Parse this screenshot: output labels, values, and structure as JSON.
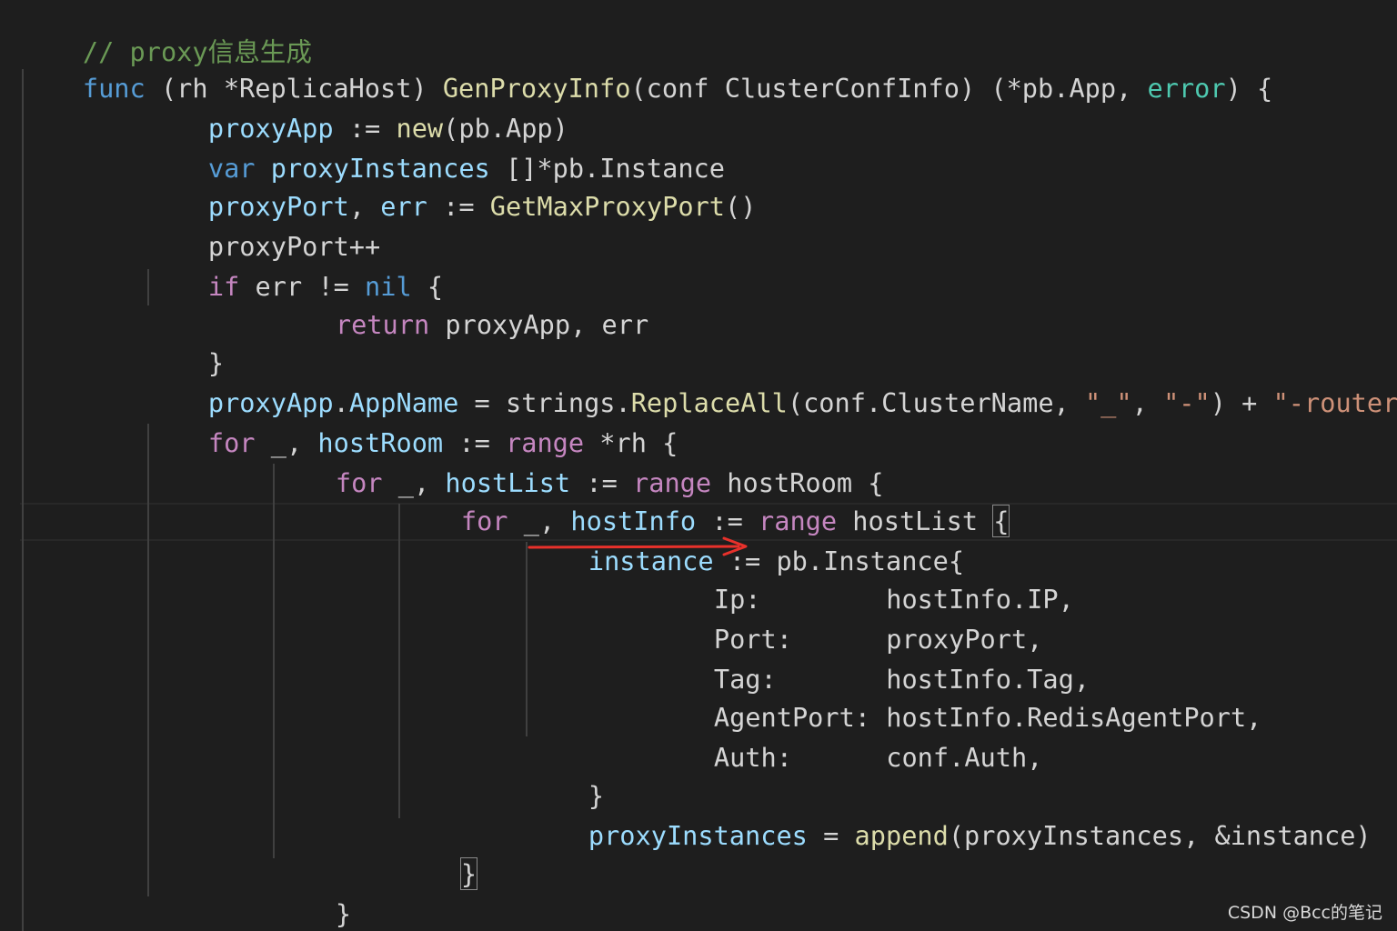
{
  "editor": {
    "language": "go",
    "theme": "dark",
    "colors": {
      "background": "#1e1e1e",
      "comment": "#6a9955",
      "keyword": "#569cd6",
      "control": "#c586c0",
      "function": "#dcdcaa",
      "variable": "#9cdcfe",
      "type": "#4ec9b0",
      "string": "#ce9178",
      "plain": "#d4d4d4",
      "annotation_arrow": "#e8312b"
    },
    "lines": [
      {
        "comment": "// proxy信息生成"
      },
      {
        "kw_func": "func",
        "p1": " (rh *ReplicaHost) ",
        "fn_name": "GenProxyInfo",
        "p2": "(conf ClusterConfInfo) (*pb.App, ",
        "type_error": "error",
        "p3": ") {"
      },
      {
        "var": "proxyApp",
        "p1": " := ",
        "fn": "new",
        "p2": "(pb.App)"
      },
      {
        "kw_var": "var",
        "p0": " ",
        "var": "proxyInstances",
        "p1": " []*pb.Instance"
      },
      {
        "var1": "proxyPort",
        "p1": ", ",
        "var2": "err",
        "p2": " := ",
        "fn": "GetMaxProxyPort",
        "p3": "()"
      },
      {
        "text": "proxyPort++"
      },
      {
        "kw_if": "if",
        "p1": " err != ",
        "kw_nil": "nil",
        "p2": " {"
      },
      {
        "kw_return": "return",
        "p1": " proxyApp, err"
      },
      {
        "text": "}"
      },
      {
        "var1": "proxyApp",
        "p1": ".",
        "var2": "AppName",
        "p2": " = strings.",
        "fn": "ReplaceAll",
        "p3": "(conf.ClusterName, ",
        "s1": "\"_\"",
        "p4": ", ",
        "s2": "\"-\"",
        "p5": ") + ",
        "s3": "\"-router\""
      },
      {
        "kw_for": "for",
        "p1": " _, ",
        "var": "hostRoom",
        "p2": " := ",
        "kw_range": "range",
        "p3": " *rh {"
      },
      {
        "kw_for": "for",
        "p1": " _, ",
        "var": "hostList",
        "p2": " := ",
        "kw_range": "range",
        "p3": " hostRoom {"
      },
      {
        "kw_for": "for",
        "p1": " _, ",
        "var": "hostInfo",
        "p2": " := ",
        "kw_range": "range",
        "p3": " hostList ",
        "brace": "{"
      },
      {
        "var": "instance",
        "p1": " := pb.Instance{"
      },
      {
        "text": "Ip:        hostInfo.IP,"
      },
      {
        "text": "Port:      proxyPort,"
      },
      {
        "text": "Tag:       hostInfo.Tag,"
      },
      {
        "text": "AgentPort: hostInfo.RedisAgentPort,"
      },
      {
        "text": "Auth:      conf.Auth,"
      },
      {
        "text": "}"
      },
      {
        "var": "proxyInstances",
        "p1": " = ",
        "fn": "append",
        "p2": "(proxyInstances, &instance)"
      },
      {
        "brace": "}"
      },
      {
        "text": "}"
      },
      {
        "text": "}"
      }
    ]
  },
  "watermark": "CSDN @Bcc的笔记"
}
